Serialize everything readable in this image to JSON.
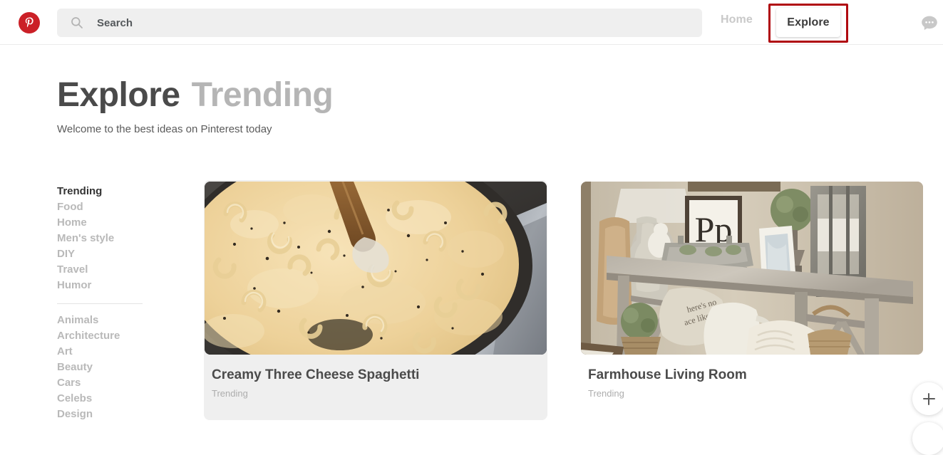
{
  "header": {
    "logo_name": "pinterest-logo",
    "search": {
      "placeholder": "Search",
      "value": ""
    },
    "nav": {
      "home_label": "Home",
      "explore_label": "Explore",
      "active": "Explore"
    },
    "messages_icon": "messages-bubble-icon"
  },
  "page": {
    "title_main": "Explore",
    "title_sub": "Trending",
    "subtitle": "Welcome to the best ideas on Pinterest today"
  },
  "sidebar": {
    "primary": [
      {
        "label": "Trending",
        "active": true
      },
      {
        "label": "Food",
        "active": false
      },
      {
        "label": "Home",
        "active": false
      },
      {
        "label": "Men's style",
        "active": false
      },
      {
        "label": "DIY",
        "active": false
      },
      {
        "label": "Travel",
        "active": false
      },
      {
        "label": "Humor",
        "active": false
      }
    ],
    "secondary": [
      {
        "label": "Animals",
        "active": false
      },
      {
        "label": "Architecture",
        "active": false
      },
      {
        "label": "Art",
        "active": false
      },
      {
        "label": "Beauty",
        "active": false
      },
      {
        "label": "Cars",
        "active": false
      },
      {
        "label": "Celebs",
        "active": false
      },
      {
        "label": "Design",
        "active": false
      }
    ]
  },
  "cards": [
    {
      "title": "Creamy Three Cheese Spaghetti",
      "subtitle": "Trending",
      "image_name": "creamy-three-cheese-spaghetti-photo",
      "hovered": true
    },
    {
      "title": "Farmhouse Living Room",
      "subtitle": "Trending",
      "image_name": "farmhouse-living-room-photo",
      "hovered": false
    }
  ],
  "floating": {
    "create_label": "+",
    "create_icon": "plus-icon"
  },
  "colors": {
    "brand_red": "#cb2027",
    "annotation_red": "#b00910",
    "search_bg": "#efefef",
    "hover_bg": "#efefef",
    "text_dark": "#4a4a4a",
    "text_muted": "#b9b9b9"
  }
}
